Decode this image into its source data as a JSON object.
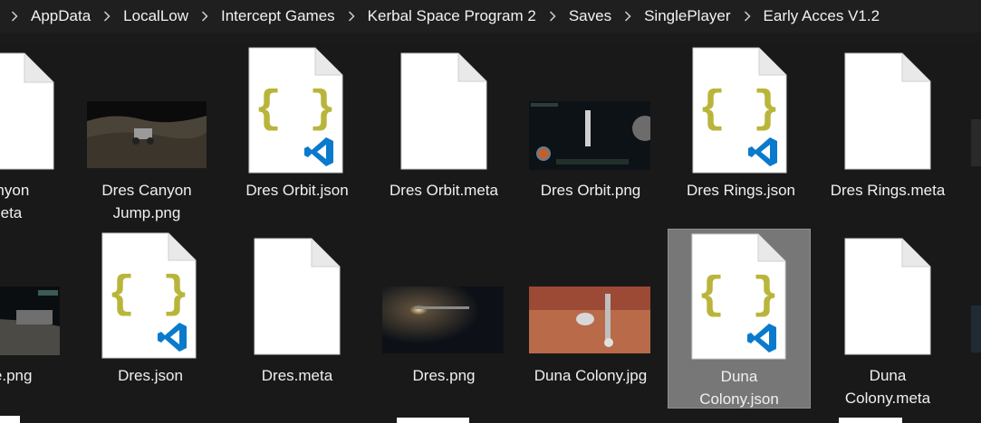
{
  "breadcrumb": [
    "AppData",
    "LocalLow",
    "Intercept Games",
    "Kerbal Space Program 2",
    "Saves",
    "SinglePlayer",
    "Early Acces V1.2"
  ],
  "files": {
    "row1": [
      {
        "name": "Canyon\n.meta",
        "type": "meta"
      },
      {
        "name": "Dres Canyon Jump.png",
        "type": "png"
      },
      {
        "name": "Dres Orbit.json",
        "type": "json"
      },
      {
        "name": "Dres Orbit.meta",
        "type": "meta"
      },
      {
        "name": "Dres Orbit.png",
        "type": "png"
      },
      {
        "name": "Dres Rings.json",
        "type": "json"
      },
      {
        "name": "Dres Rings.meta",
        "type": "meta"
      }
    ],
    "row2": [
      {
        "name": "rface.png",
        "type": "png"
      },
      {
        "name": "Dres.json",
        "type": "json"
      },
      {
        "name": "Dres.meta",
        "type": "meta"
      },
      {
        "name": "Dres.png",
        "type": "png"
      },
      {
        "name": "Duna Colony.jpg",
        "type": "jpg"
      },
      {
        "name": "Duna Colony.json",
        "type": "json",
        "selected": true
      },
      {
        "name": "Duna Colony.meta",
        "type": "meta"
      }
    ]
  },
  "colors": {
    "background": "#191919",
    "selection": "#777777",
    "json_brace": "#b9b53a",
    "vscode_blue": "#0a7acc"
  }
}
